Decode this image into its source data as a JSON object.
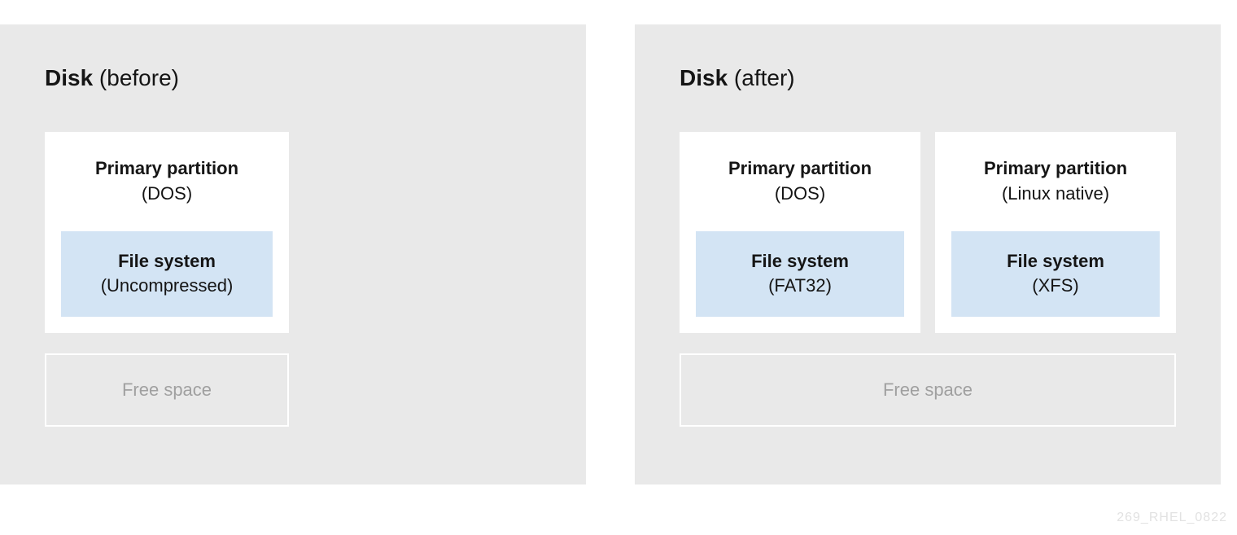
{
  "before": {
    "title_bold": "Disk",
    "title_rest": " (before)",
    "partition": {
      "label_strong": "Primary partition",
      "label_sub": "(DOS)",
      "fs_strong": "File system",
      "fs_sub": "(Uncompressed)"
    },
    "free_space": "Free space"
  },
  "after": {
    "title_bold": "Disk",
    "title_rest": " (after)",
    "partition1": {
      "label_strong": "Primary partition",
      "label_sub": "(DOS)",
      "fs_strong": "File system",
      "fs_sub": "(FAT32)"
    },
    "partition2": {
      "label_strong": "Primary partition",
      "label_sub": "(Linux native)",
      "fs_strong": "File system",
      "fs_sub": "(XFS)"
    },
    "free_space": "Free space"
  },
  "watermark": "269_RHEL_0822"
}
